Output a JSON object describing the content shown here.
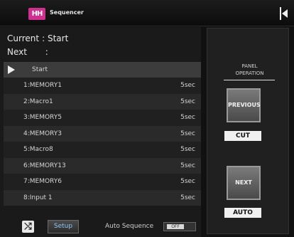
{
  "titlebar": {
    "logo_text": "HH",
    "title": "Sequencer",
    "brand_color": "#cf2f8e"
  },
  "status": {
    "current_label": "Current",
    "current_value": "Start",
    "next_label": "Next",
    "next_value": ""
  },
  "list": {
    "header": {
      "name": "Start"
    },
    "rows": [
      {
        "name": "1:MEMORY1",
        "duration": "5sec"
      },
      {
        "name": "2:Macro1",
        "duration": "5sec"
      },
      {
        "name": "3:MEMORY5",
        "duration": "5sec"
      },
      {
        "name": "4:MEMORY3",
        "duration": "5sec"
      },
      {
        "name": "5:Macro8",
        "duration": "5sec"
      },
      {
        "name": "6:MEMORY13",
        "duration": "5sec"
      },
      {
        "name": "7:MEMORY6",
        "duration": "5sec"
      },
      {
        "name": "8:Input 1",
        "duration": "5sec"
      }
    ]
  },
  "bottom": {
    "setup_label": "Setup",
    "auto_sequence_label": "Auto Sequence",
    "toggle_value": "OFF"
  },
  "panel": {
    "title": "PANEL\nOPERATION",
    "previous_label": "PREVIOUS",
    "cut_label": "CUT",
    "next_label": "NEXT",
    "auto_label": "AUTO"
  }
}
